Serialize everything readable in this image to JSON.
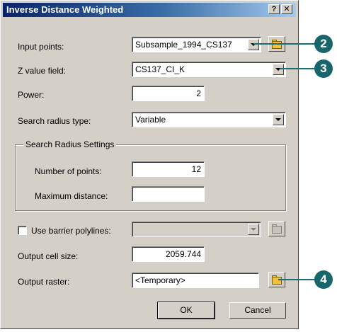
{
  "dialog": {
    "title": "Inverse Distance Weighted",
    "help_glyph": "?",
    "close_glyph": "✕"
  },
  "fields": {
    "input_points": {
      "label": "Input points:",
      "value": "Subsample_1994_CS137"
    },
    "z_value_field": {
      "label": "Z value field:",
      "value": "CS137_CI_K"
    },
    "power": {
      "label": "Power:",
      "value": "2"
    },
    "search_radius_type": {
      "label": "Search radius type:",
      "value": "Variable"
    },
    "search_radius_settings": {
      "legend": "Search Radius Settings",
      "number_of_points": {
        "label": "Number of points:",
        "value": "12"
      },
      "maximum_distance": {
        "label": "Maximum distance:",
        "value": ""
      }
    },
    "use_barrier_polylines": {
      "label": "Use barrier polylines:",
      "checked": false,
      "value": ""
    },
    "output_cell_size": {
      "label": "Output cell size:",
      "value": "2059.744"
    },
    "output_raster": {
      "label": "Output raster:",
      "value": "<Temporary>"
    }
  },
  "buttons": {
    "ok": "OK",
    "cancel": "Cancel"
  },
  "callouts": {
    "input_points": "2",
    "z_value_field": "3",
    "output_raster": "4"
  },
  "colors": {
    "titlebar_start": "#0a246a",
    "dialog_bg": "#d4d0c8",
    "callout": "#18666b"
  },
  "icons": {
    "open_folder": "open-folder-icon",
    "dropdown": "chevron-down-icon"
  }
}
